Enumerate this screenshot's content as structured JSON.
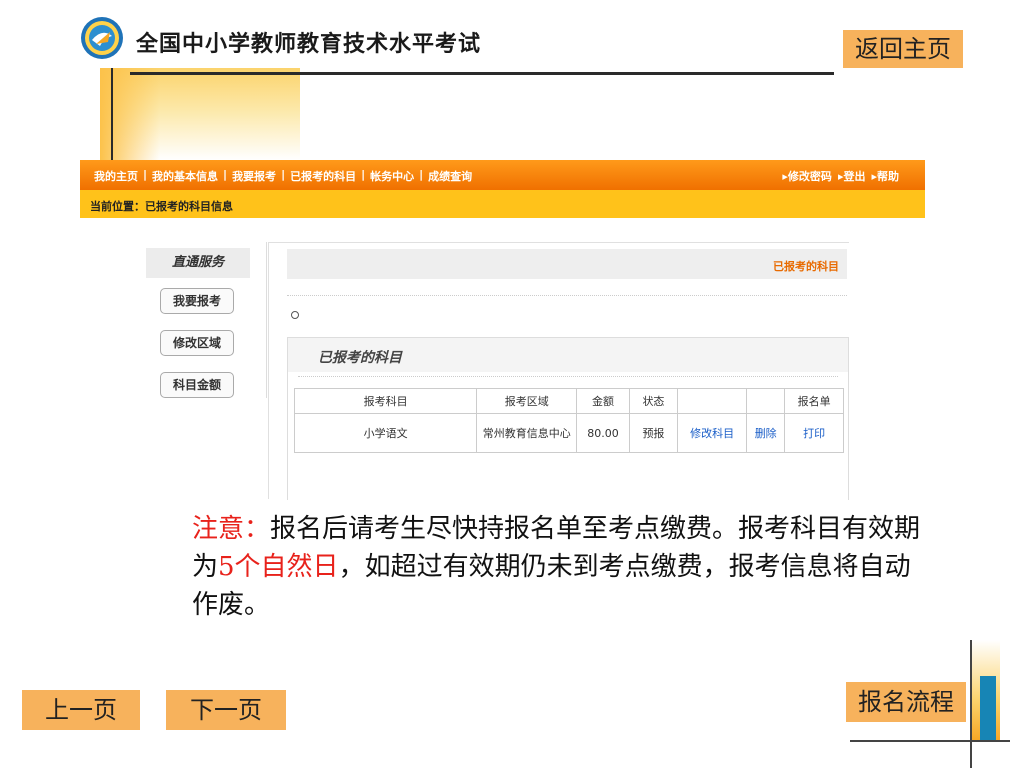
{
  "slide": {
    "title": "全国中小学教师教育技术水平考试",
    "home_button": "返回主页",
    "prev_button": "上一页",
    "next_button": "下一页",
    "flow_button": "报名流程"
  },
  "site": {
    "nav": {
      "items": [
        "我的主页",
        "我的基本信息",
        "我要报考",
        "已报考的科目",
        "帐务中心",
        "成绩查询"
      ],
      "separator": "|",
      "right_items": [
        "▸修改密码",
        "▸登出",
        "▸帮助"
      ]
    },
    "breadcrumb": "当前位置：已报考的科目信息",
    "sidebar": {
      "title": "直通服务",
      "buttons": [
        "我要报考",
        "修改区域",
        "科目金额"
      ]
    },
    "main": {
      "header_label": "已报考的科目",
      "panel_title": "已报考的科目",
      "table": {
        "headers": [
          "报考科目",
          "报考区域",
          "金额",
          "状态",
          "",
          "",
          "报名单"
        ],
        "rows": [
          {
            "subject": "小学语文",
            "region": "常州教育信息中心",
            "amount": "80.00",
            "status": "预报",
            "edit": "修改科目",
            "delete": "删除",
            "print": "打印"
          }
        ]
      }
    }
  },
  "notice": {
    "label": "注意：",
    "part1": "报名后请考生尽快持报名单至考点缴费。报考科目有效期为",
    "highlight": "5个自然日",
    "part2": "，如超过有效期仍未到考点缴费，报考信息将自动作废。"
  },
  "colors": {
    "nav_orange": "#f07000",
    "crumb_yellow": "#ffc21a",
    "button_orange": "#f7b25c",
    "notice_red": "#e8221b",
    "link_blue": "#1a5ec8"
  },
  "icons": {
    "logo": "exam-logo-icon"
  }
}
